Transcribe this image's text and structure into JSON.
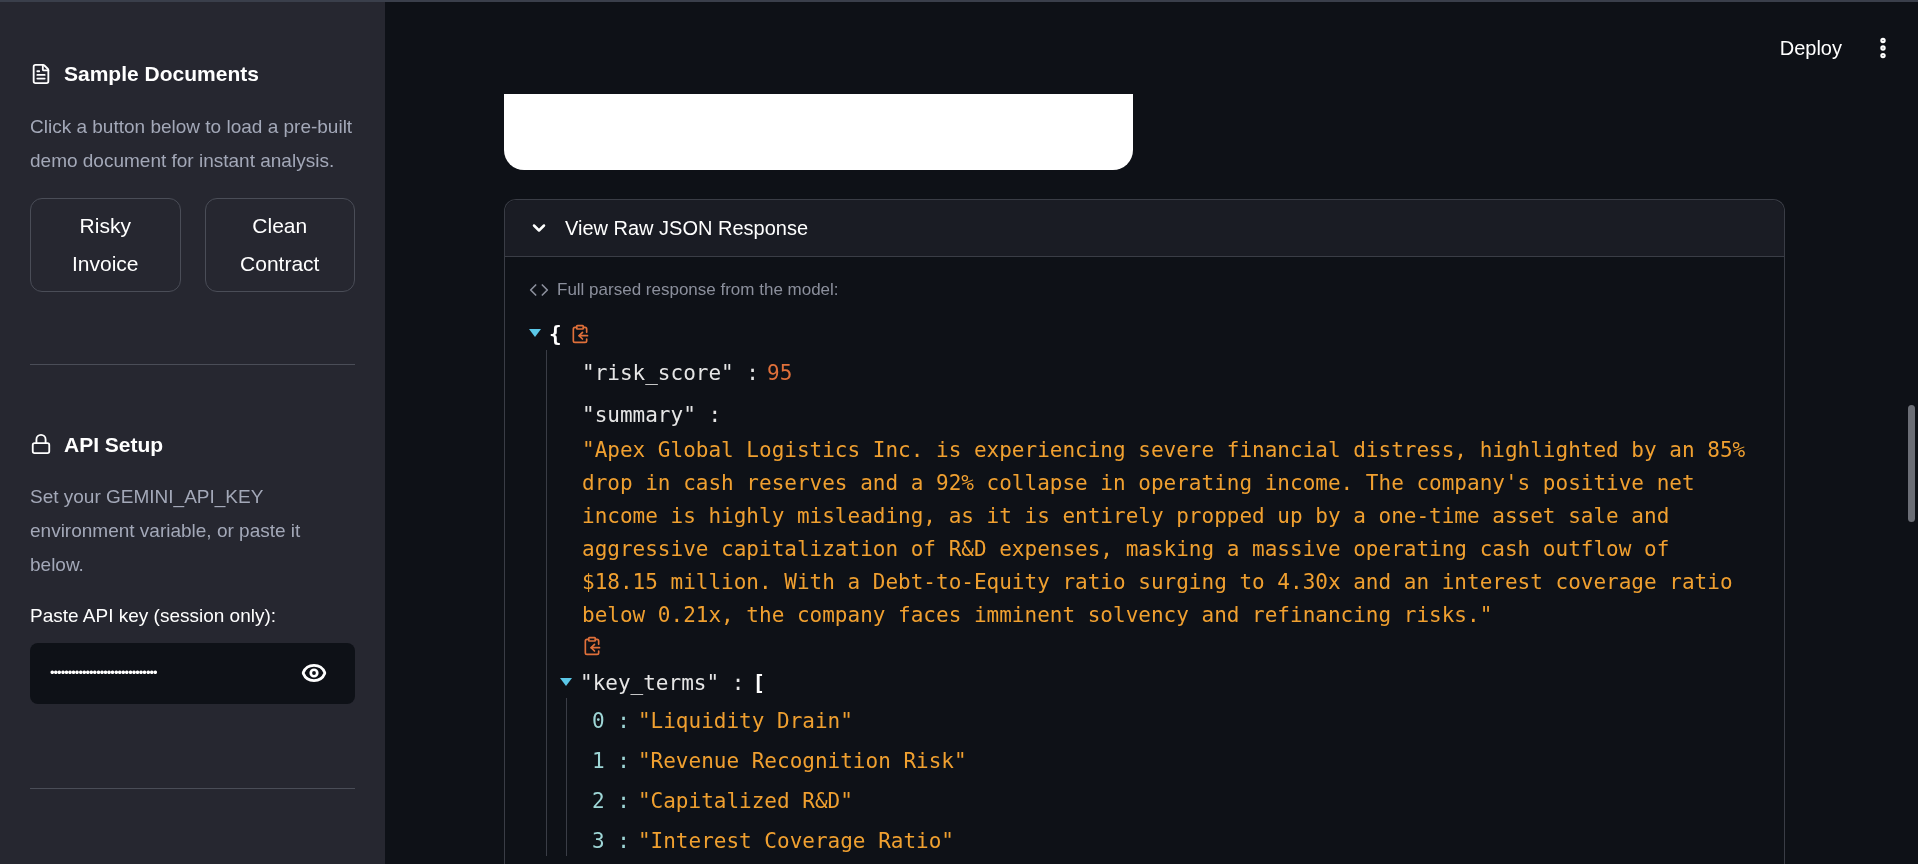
{
  "sidebar": {
    "sections": [
      {
        "kind": "samples",
        "title": "Sample Documents",
        "description": "Click a button below to load a pre-built demo document for instant analysis.",
        "buttons": [
          "Risky Invoice",
          "Clean Contract"
        ]
      },
      {
        "kind": "api",
        "title": "API Setup",
        "description": "Set your GEMINI_API_KEY environment variable, or paste it below.",
        "field_label": "Paste API key (session only):",
        "field_value": "••••••••••••••••••••••••••••••"
      }
    ]
  },
  "header": {
    "deploy": "Deploy"
  },
  "expander": {
    "title": "View Raw JSON Response",
    "expanded": true,
    "caption": "Full parsed response from the model:",
    "json": {
      "open": "{",
      "expanded": true,
      "entries": [
        {
          "kind": "number",
          "key": "\"risk_score\" :",
          "value": "95"
        },
        {
          "kind": "string",
          "key": "\"summary\" :",
          "value": "\"Apex Global Logistics Inc. is experiencing severe financial distress, highlighted by an 85% drop in cash reserves and a 92% collapse in operating income. The company's positive net income is highly misleading, as it is entirely propped up by a one-time asset sale and aggressive capitalization of R&D expenses, masking a massive operating cash outflow of $18.15 million. With a Debt-to-Equity ratio surging to 4.30x and an interest coverage ratio below 0.21x, the company faces imminent solvency and refinancing risks.\""
        },
        {
          "kind": "array",
          "key": "\"key_terms\" :",
          "open": "[",
          "expanded": true,
          "items": [
            {
              "index": "0 :",
              "value": "\"Liquidity Drain\""
            },
            {
              "index": "1 :",
              "value": "\"Revenue Recognition Risk\""
            },
            {
              "index": "2 :",
              "value": "\"Capitalized R&D\""
            },
            {
              "index": "3 :",
              "value": "\"Interest Coverage Ratio\""
            }
          ]
        }
      ]
    }
  }
}
